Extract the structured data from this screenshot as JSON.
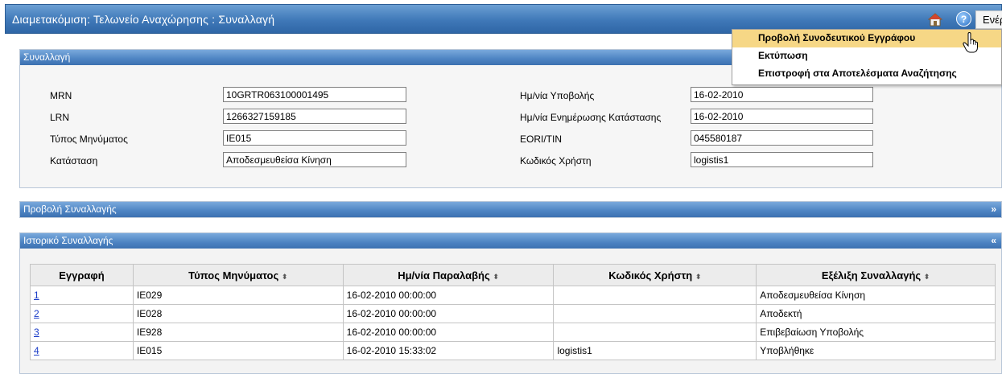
{
  "window": {
    "title": "Διαμετακόμιση: Τελωνείο Αναχώρησης : Συναλλαγή",
    "actions_label": "Ενέργειες"
  },
  "actions_menu": [
    {
      "label": "Προβολή Συνοδευτικού Εγγράφου",
      "highlighted": true
    },
    {
      "label": "Εκτύπωση",
      "highlighted": false
    },
    {
      "label": "Επιστροφή στα Αποτελέσματα Αναζήτησης",
      "highlighted": false
    }
  ],
  "transaction_panel": {
    "header": "Συναλλαγή",
    "left_fields": [
      {
        "label": "MRN",
        "value": "10GRTR063100001495"
      },
      {
        "label": "LRN",
        "value": "1266327159185"
      },
      {
        "label": "Τύπος Μηνύματος",
        "value": "IE015"
      },
      {
        "label": "Κατάσταση",
        "value": "Αποδεσμευθείσα Κίνηση"
      }
    ],
    "right_fields": [
      {
        "label": "Ημ/νία Υποβολής",
        "value": "16-02-2010"
      },
      {
        "label": "Ημ/νία Ενημέρωσης Κατάστασης",
        "value": "16-02-2010"
      },
      {
        "label": "EORI/TIN",
        "value": "045580187"
      },
      {
        "label": "Κωδικός Χρήστη",
        "value": "logistis1"
      }
    ]
  },
  "view_panel": {
    "header": "Προβολή Συναλλαγής",
    "toggle": "»"
  },
  "history_panel": {
    "header": "Ιστορικό Συναλλαγής",
    "toggle": "«",
    "columns": [
      "Εγγραφή",
      "Τύπος Μηνύματος",
      "Ημ/νία Παραλαβής",
      "Κωδικός Χρήστη",
      "Εξέλιξη Συναλλαγής"
    ],
    "sort_glyph": "⬍",
    "rows": [
      {
        "entry": "1",
        "type": "IE029",
        "date": "16-02-2010 00:00:00",
        "user": "",
        "status": "Αποδεσμευθείσα Κίνηση"
      },
      {
        "entry": "2",
        "type": "IE028",
        "date": "16-02-2010 00:00:00",
        "user": "",
        "status": "Αποδεκτή"
      },
      {
        "entry": "3",
        "type": "IE928",
        "date": "16-02-2010 00:00:00",
        "user": "",
        "status": "Επιβεβαίωση Υποβολής"
      },
      {
        "entry": "4",
        "type": "IE015",
        "date": "16-02-2010 15:33:02",
        "user": "logistis1",
        "status": "Υποβλήθηκε"
      }
    ]
  },
  "colors": {
    "header_blue": "#3f78b8",
    "menu_highlight": "#f6d786",
    "link": "#1a3cc8"
  },
  "icons": [
    "home-icon",
    "help-icon",
    "hand-cursor-icon"
  ]
}
